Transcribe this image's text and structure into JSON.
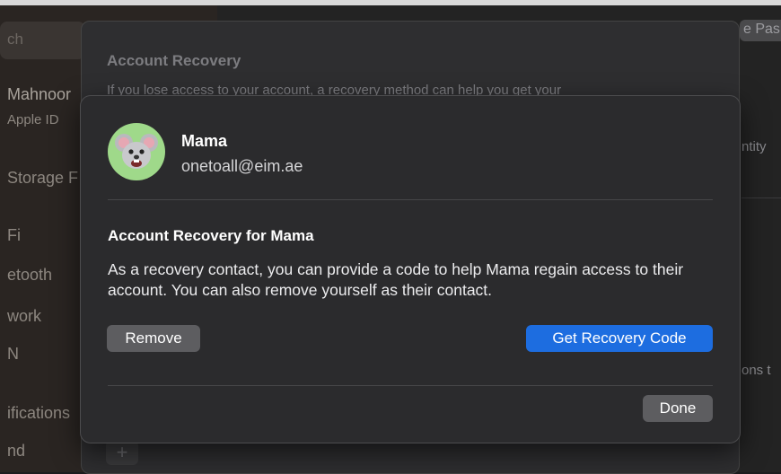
{
  "background": {
    "search_placeholder": "ch",
    "sidebar_items": [
      "Mahnoor",
      "Apple ID",
      "Storage F",
      "Fi",
      "etooth",
      "work",
      "N",
      "ifications",
      "nd"
    ],
    "right_partial": {
      "top_button": "e Pas",
      "line1": "ntity",
      "line2": "ons t"
    },
    "sheet": {
      "title": "Account Recovery",
      "subtitle": "If you lose access to your account, a recovery method can help you get your"
    },
    "add_button": "+"
  },
  "dialog": {
    "contact_name": "Mama",
    "contact_email": "onetoall@eim.ae",
    "heading": "Account Recovery for Mama",
    "body": "As a recovery contact, you can provide a code to help Mama regain access to their account. You can also remove yourself as their contact.",
    "remove_label": "Remove",
    "get_code_label": "Get Recovery Code",
    "done_label": "Done"
  },
  "colors": {
    "accent": "#1d6de0",
    "avatar_bg": "#9fd98a"
  }
}
